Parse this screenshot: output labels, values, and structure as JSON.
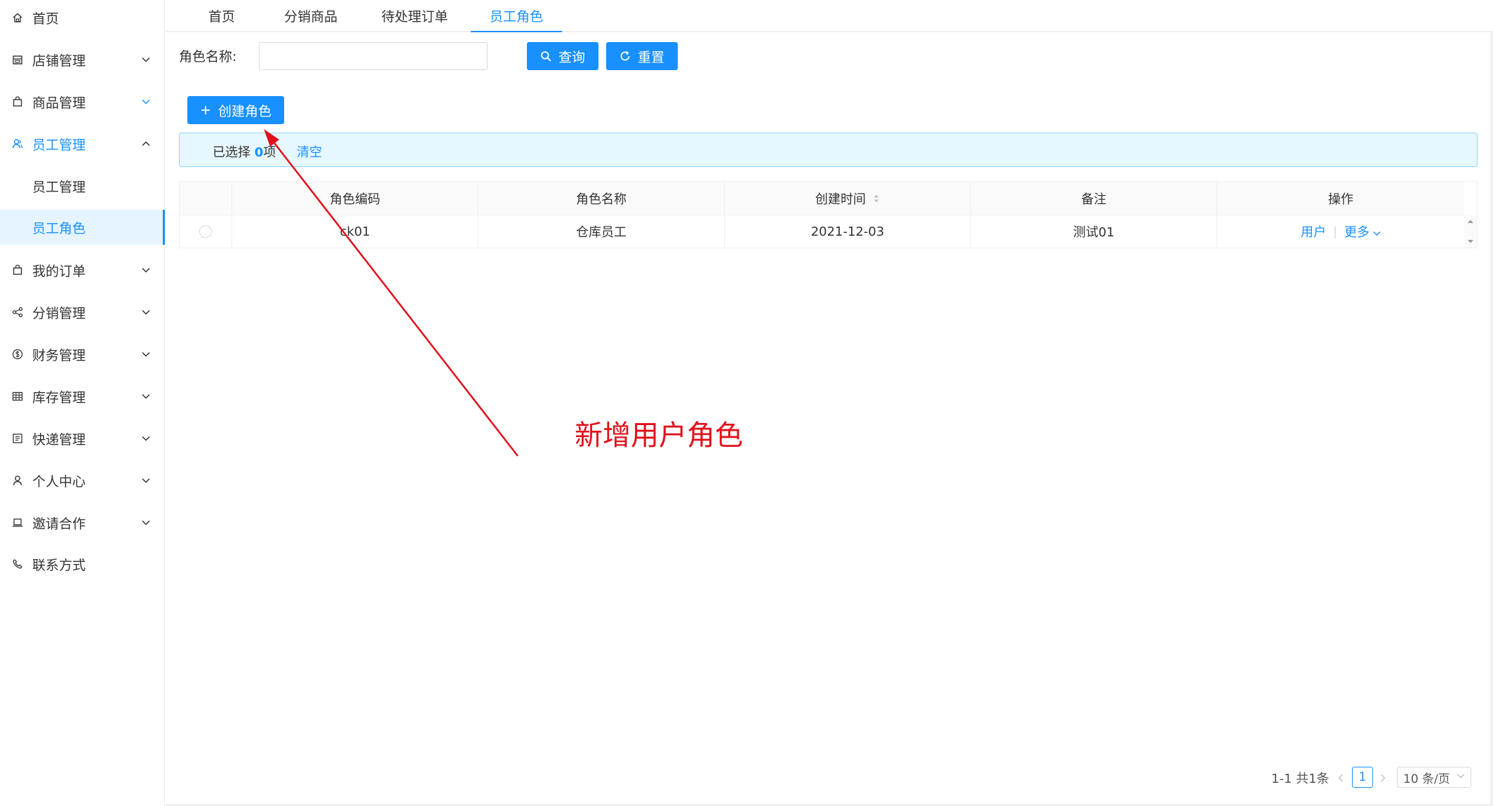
{
  "sidebar": {
    "items": [
      {
        "label": "首页",
        "icon": "home-icon"
      },
      {
        "label": "店铺管理",
        "icon": "shop-icon"
      },
      {
        "label": "商品管理",
        "icon": "bag-icon"
      },
      {
        "label": "员工管理",
        "icon": "staff-icon"
      },
      {
        "label": "员工管理"
      },
      {
        "label": "员工角色"
      },
      {
        "label": "我的订单",
        "icon": "order-bag-icon"
      },
      {
        "label": "分销管理",
        "icon": "share-icon"
      },
      {
        "label": "财务管理",
        "icon": "dollar-icon"
      },
      {
        "label": "库存管理",
        "icon": "grid-icon"
      },
      {
        "label": "快递管理",
        "icon": "list-icon"
      },
      {
        "label": "个人中心",
        "icon": "user-icon"
      },
      {
        "label": "邀请合作",
        "icon": "laptop-icon"
      },
      {
        "label": "联系方式",
        "icon": "phone-icon"
      }
    ]
  },
  "tabs": [
    {
      "label": "首页"
    },
    {
      "label": "分销商品"
    },
    {
      "label": "待处理订单"
    },
    {
      "label": "员工角色"
    }
  ],
  "search": {
    "label": "角色名称:",
    "value": "",
    "query_label": "查询",
    "reset_label": "重置"
  },
  "toolbar": {
    "create_label": "创建角色"
  },
  "selection": {
    "prefix": "已选择 ",
    "count": "0",
    "suffix": "项",
    "clear_label": "清空"
  },
  "table": {
    "columns": [
      "角色编码",
      "角色名称",
      "创建时间",
      "备注",
      "操作"
    ],
    "rows": [
      {
        "code": "ck01",
        "name": "仓库员工",
        "created": "2021-12-03",
        "remark": "测试01",
        "op_user": "用户",
        "op_more": "更多"
      }
    ]
  },
  "pagination": {
    "total": "1-1 共1条",
    "page": "1",
    "page_size": "10 条/页"
  },
  "annotation": {
    "text": "新增用户角色",
    "color": "#e0101b"
  },
  "colors": {
    "primary": "#1890ff",
    "alert_bg": "#e6f7ff"
  }
}
